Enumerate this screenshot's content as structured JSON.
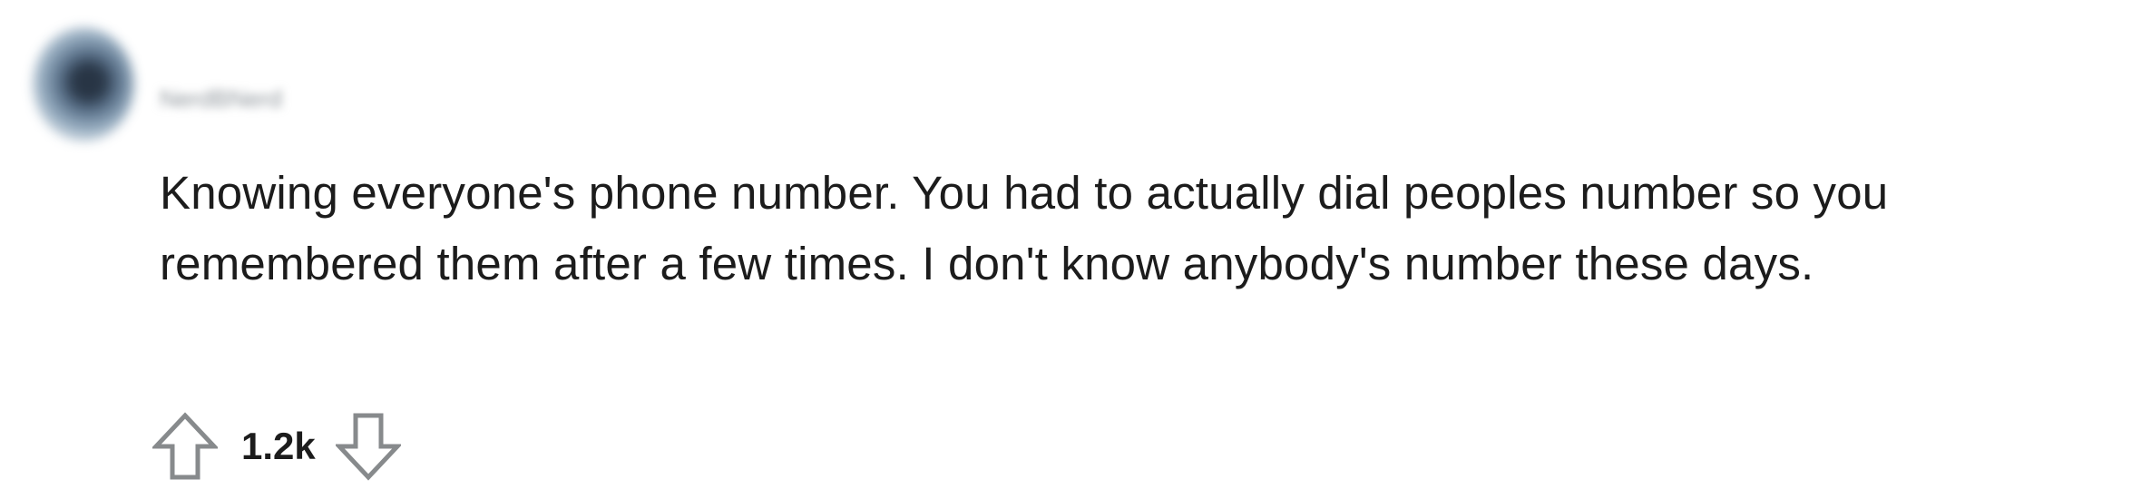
{
  "comment": {
    "author": "NerdBNerd",
    "body": "Knowing everyone's phone number. You had to actually dial peoples number so you remembered them after a few times. I don't know anybody's number these days.",
    "score": "1.2k"
  },
  "icons": {
    "avatar": "user-avatar",
    "upvote": "upvote-icon",
    "downvote": "downvote-icon"
  },
  "colors": {
    "text": "#1c1c1c",
    "icon_stroke": "#878a8c",
    "muted": "#8f969c",
    "background": "#ffffff"
  }
}
